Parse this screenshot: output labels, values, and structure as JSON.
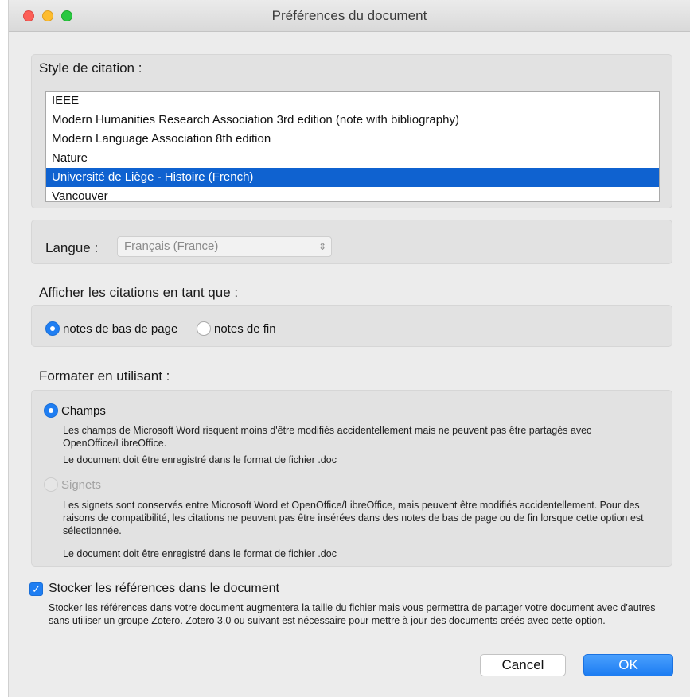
{
  "window": {
    "title": "Préférences du document"
  },
  "citation_style": {
    "label": "Style de citation :",
    "items": [
      "IEEE",
      "Modern Humanities Research Association 3rd edition (note with bibliography)",
      "Modern Language Association 8th edition",
      "Nature",
      "Université de Liège - Histoire (French)",
      "Vancouver"
    ],
    "selected_index": 4
  },
  "language": {
    "label": "Langue :",
    "value": "Français (France)"
  },
  "display": {
    "label": "Afficher les citations en tant que :",
    "options": [
      "notes de bas de page",
      "notes de fin"
    ],
    "selected": "notes de bas de page"
  },
  "format": {
    "label": "Formater en utilisant :",
    "fields": {
      "label": "Champs",
      "desc1": "Les champs de Microsoft Word risquent moins d'être modifiés accidentellement mais ne peuvent pas être partagés avec OpenOffice/LibreOffice.",
      "desc2": "Le document doit être enregistré dans le format de fichier .doc"
    },
    "bookmarks": {
      "label": "Signets",
      "desc1": "Les signets sont conservés entre Microsoft Word et OpenOffice/LibreOffice, mais peuvent être modifiés accidentellement. Pour des raisons de compatibilité, les citations ne peuvent pas être insérées dans des notes de bas de page ou de fin lorsque cette option est sélectionnée.",
      "desc2": "Le document doit être enregistré dans le format de fichier .doc"
    },
    "selected": "Champs"
  },
  "store_refs": {
    "label": "Stocker les références dans le document",
    "checked": true,
    "desc": "Stocker les références dans votre document augmentera la taille du fichier mais vous permettra de partager votre document avec d'autres sans utiliser un groupe Zotero. Zotero 3.0 ou suivant est nécessaire pour mettre à jour des documents créés avec cette option."
  },
  "buttons": {
    "cancel": "Cancel",
    "ok": "OK"
  },
  "colors": {
    "accent": "#1f7ef2",
    "selection": "#0f62d0"
  }
}
